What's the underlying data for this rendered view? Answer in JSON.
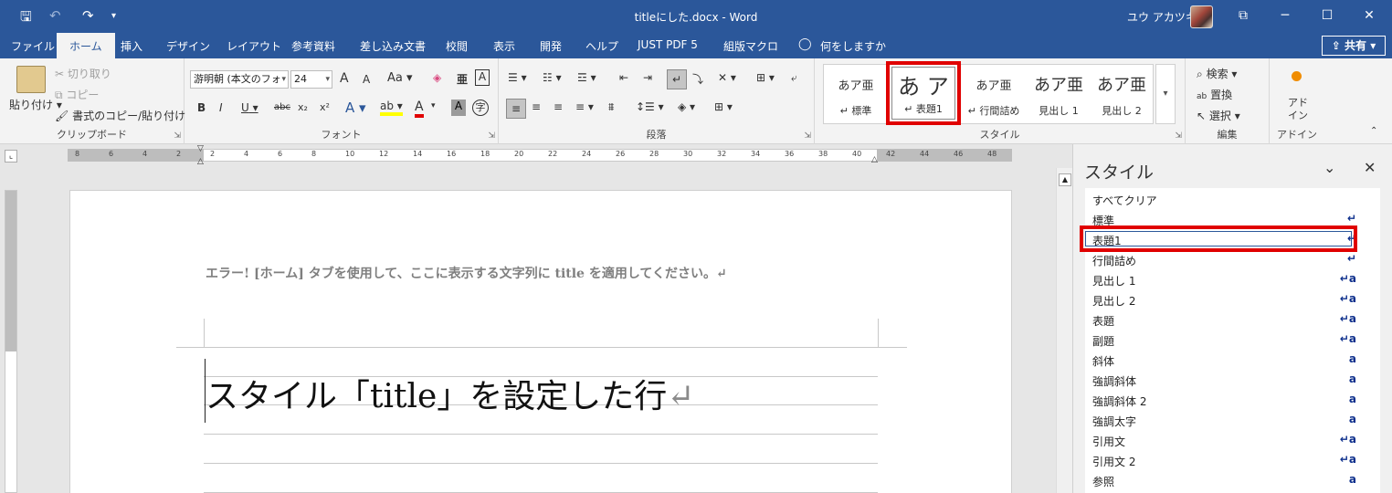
{
  "window": {
    "title": "titleにした.docx - Word",
    "user": "ユウ アカツキ",
    "qat": {
      "save": "🖫",
      "undo": "↶",
      "redo": "↷",
      "customize": "▾"
    },
    "controls": {
      "ribbon_display": "⧉",
      "minimize": "─",
      "maximize": "☐",
      "close": "✕"
    }
  },
  "tabs": [
    "ファイル",
    "ホーム",
    "挿入",
    "デザイン",
    "レイアウト",
    "参考資料",
    "差し込み文書",
    "校閲",
    "表示",
    "開発",
    "ヘルプ",
    "JUST PDF 5",
    "組版マクロ",
    "何をしますか"
  ],
  "share_label": "共有",
  "share_icon": "⇪",
  "tellme_icon": "lightbulb-icon",
  "ribbon": {
    "clipboard": {
      "label": "クリップボード",
      "paste": "貼り付け",
      "cut": "切り取り",
      "copy": "コピー",
      "format_painter": "書式のコピー/貼り付け"
    },
    "font": {
      "label": "フォント",
      "font_name": "游明朝 (本文のフォ",
      "font_size": "24",
      "grow": "A",
      "shrink": "A",
      "case": "Aa",
      "bold": "B",
      "italic": "I",
      "underline": "U",
      "strike": "abc",
      "sub": "x₂",
      "sup": "x²"
    },
    "paragraph": {
      "label": "段落"
    },
    "styles": {
      "label": "スタイル",
      "gallery": [
        {
          "sample": "あア亜",
          "name": "↵ 標準"
        },
        {
          "sample": "あ ア",
          "name": "↵ 表題1"
        },
        {
          "sample": "あア亜",
          "name": "↵ 行間詰め"
        },
        {
          "sample": "あア亜",
          "name": "見出し 1"
        },
        {
          "sample": "あア亜",
          "name": "見出し 2"
        }
      ]
    },
    "editing": {
      "label": "編集",
      "find": "検索",
      "replace": "置換",
      "select": "選択"
    },
    "addins": {
      "label": "アドイン",
      "button": "アド\nイン"
    }
  },
  "ruler_numbers": [
    "8",
    "6",
    "4",
    "2",
    "2",
    "4",
    "6",
    "8",
    "10",
    "12",
    "14",
    "16",
    "18",
    "20",
    "22",
    "24",
    "26",
    "28",
    "30",
    "32",
    "34",
    "36",
    "38",
    "40",
    "42",
    "44",
    "46",
    "48"
  ],
  "document": {
    "error_text": "エラー! [ホーム] タブを使用して、ここに表示する文字列に title を適用してください。↵",
    "title_text": "スタイル「title」を設定した行",
    "title_mark": "↵"
  },
  "style_pane": {
    "title": "スタイル",
    "items": [
      {
        "name": "すべてクリア",
        "icon": ""
      },
      {
        "name": "標準",
        "icon": "↵"
      },
      {
        "name": "表題1",
        "icon": "↵"
      },
      {
        "name": "行間詰め",
        "icon": "↵"
      },
      {
        "name": "見出し 1",
        "icon": "↵a"
      },
      {
        "name": "見出し 2",
        "icon": "↵a"
      },
      {
        "name": "表題",
        "icon": "↵a"
      },
      {
        "name": "副題",
        "icon": "↵a"
      },
      {
        "name": "斜体",
        "icon": "a"
      },
      {
        "name": "強調斜体",
        "icon": "a"
      },
      {
        "name": "強調斜体 2",
        "icon": "a"
      },
      {
        "name": "強調太字",
        "icon": "a"
      },
      {
        "name": "引用文",
        "icon": "↵a"
      },
      {
        "name": "引用文 2",
        "icon": "↵a"
      },
      {
        "name": "参照",
        "icon": "a"
      }
    ]
  },
  "colors": {
    "accent": "#2b579a",
    "highlight_red": "#e00000"
  }
}
